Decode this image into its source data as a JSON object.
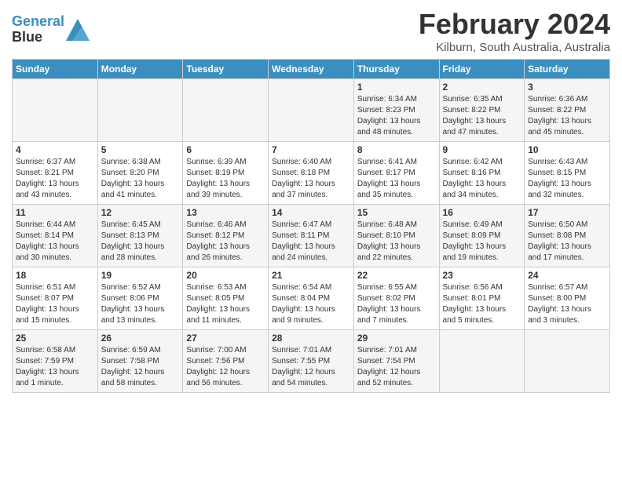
{
  "logo": {
    "line1": "General",
    "line2": "Blue"
  },
  "title": "February 2024",
  "location": "Kilburn, South Australia, Australia",
  "days_of_week": [
    "Sunday",
    "Monday",
    "Tuesday",
    "Wednesday",
    "Thursday",
    "Friday",
    "Saturday"
  ],
  "weeks": [
    [
      {
        "day": "",
        "info": ""
      },
      {
        "day": "",
        "info": ""
      },
      {
        "day": "",
        "info": ""
      },
      {
        "day": "",
        "info": ""
      },
      {
        "day": "1",
        "info": "Sunrise: 6:34 AM\nSunset: 8:23 PM\nDaylight: 13 hours\nand 48 minutes."
      },
      {
        "day": "2",
        "info": "Sunrise: 6:35 AM\nSunset: 8:22 PM\nDaylight: 13 hours\nand 47 minutes."
      },
      {
        "day": "3",
        "info": "Sunrise: 6:36 AM\nSunset: 8:22 PM\nDaylight: 13 hours\nand 45 minutes."
      }
    ],
    [
      {
        "day": "4",
        "info": "Sunrise: 6:37 AM\nSunset: 8:21 PM\nDaylight: 13 hours\nand 43 minutes."
      },
      {
        "day": "5",
        "info": "Sunrise: 6:38 AM\nSunset: 8:20 PM\nDaylight: 13 hours\nand 41 minutes."
      },
      {
        "day": "6",
        "info": "Sunrise: 6:39 AM\nSunset: 8:19 PM\nDaylight: 13 hours\nand 39 minutes."
      },
      {
        "day": "7",
        "info": "Sunrise: 6:40 AM\nSunset: 8:18 PM\nDaylight: 13 hours\nand 37 minutes."
      },
      {
        "day": "8",
        "info": "Sunrise: 6:41 AM\nSunset: 8:17 PM\nDaylight: 13 hours\nand 35 minutes."
      },
      {
        "day": "9",
        "info": "Sunrise: 6:42 AM\nSunset: 8:16 PM\nDaylight: 13 hours\nand 34 minutes."
      },
      {
        "day": "10",
        "info": "Sunrise: 6:43 AM\nSunset: 8:15 PM\nDaylight: 13 hours\nand 32 minutes."
      }
    ],
    [
      {
        "day": "11",
        "info": "Sunrise: 6:44 AM\nSunset: 8:14 PM\nDaylight: 13 hours\nand 30 minutes."
      },
      {
        "day": "12",
        "info": "Sunrise: 6:45 AM\nSunset: 8:13 PM\nDaylight: 13 hours\nand 28 minutes."
      },
      {
        "day": "13",
        "info": "Sunrise: 6:46 AM\nSunset: 8:12 PM\nDaylight: 13 hours\nand 26 minutes."
      },
      {
        "day": "14",
        "info": "Sunrise: 6:47 AM\nSunset: 8:11 PM\nDaylight: 13 hours\nand 24 minutes."
      },
      {
        "day": "15",
        "info": "Sunrise: 6:48 AM\nSunset: 8:10 PM\nDaylight: 13 hours\nand 22 minutes."
      },
      {
        "day": "16",
        "info": "Sunrise: 6:49 AM\nSunset: 8:09 PM\nDaylight: 13 hours\nand 19 minutes."
      },
      {
        "day": "17",
        "info": "Sunrise: 6:50 AM\nSunset: 8:08 PM\nDaylight: 13 hours\nand 17 minutes."
      }
    ],
    [
      {
        "day": "18",
        "info": "Sunrise: 6:51 AM\nSunset: 8:07 PM\nDaylight: 13 hours\nand 15 minutes."
      },
      {
        "day": "19",
        "info": "Sunrise: 6:52 AM\nSunset: 8:06 PM\nDaylight: 13 hours\nand 13 minutes."
      },
      {
        "day": "20",
        "info": "Sunrise: 6:53 AM\nSunset: 8:05 PM\nDaylight: 13 hours\nand 11 minutes."
      },
      {
        "day": "21",
        "info": "Sunrise: 6:54 AM\nSunset: 8:04 PM\nDaylight: 13 hours\nand 9 minutes."
      },
      {
        "day": "22",
        "info": "Sunrise: 6:55 AM\nSunset: 8:02 PM\nDaylight: 13 hours\nand 7 minutes."
      },
      {
        "day": "23",
        "info": "Sunrise: 6:56 AM\nSunset: 8:01 PM\nDaylight: 13 hours\nand 5 minutes."
      },
      {
        "day": "24",
        "info": "Sunrise: 6:57 AM\nSunset: 8:00 PM\nDaylight: 13 hours\nand 3 minutes."
      }
    ],
    [
      {
        "day": "25",
        "info": "Sunrise: 6:58 AM\nSunset: 7:59 PM\nDaylight: 13 hours\nand 1 minute."
      },
      {
        "day": "26",
        "info": "Sunrise: 6:59 AM\nSunset: 7:58 PM\nDaylight: 12 hours\nand 58 minutes."
      },
      {
        "day": "27",
        "info": "Sunrise: 7:00 AM\nSunset: 7:56 PM\nDaylight: 12 hours\nand 56 minutes."
      },
      {
        "day": "28",
        "info": "Sunrise: 7:01 AM\nSunset: 7:55 PM\nDaylight: 12 hours\nand 54 minutes."
      },
      {
        "day": "29",
        "info": "Sunrise: 7:01 AM\nSunset: 7:54 PM\nDaylight: 12 hours\nand 52 minutes."
      },
      {
        "day": "",
        "info": ""
      },
      {
        "day": "",
        "info": ""
      }
    ]
  ]
}
